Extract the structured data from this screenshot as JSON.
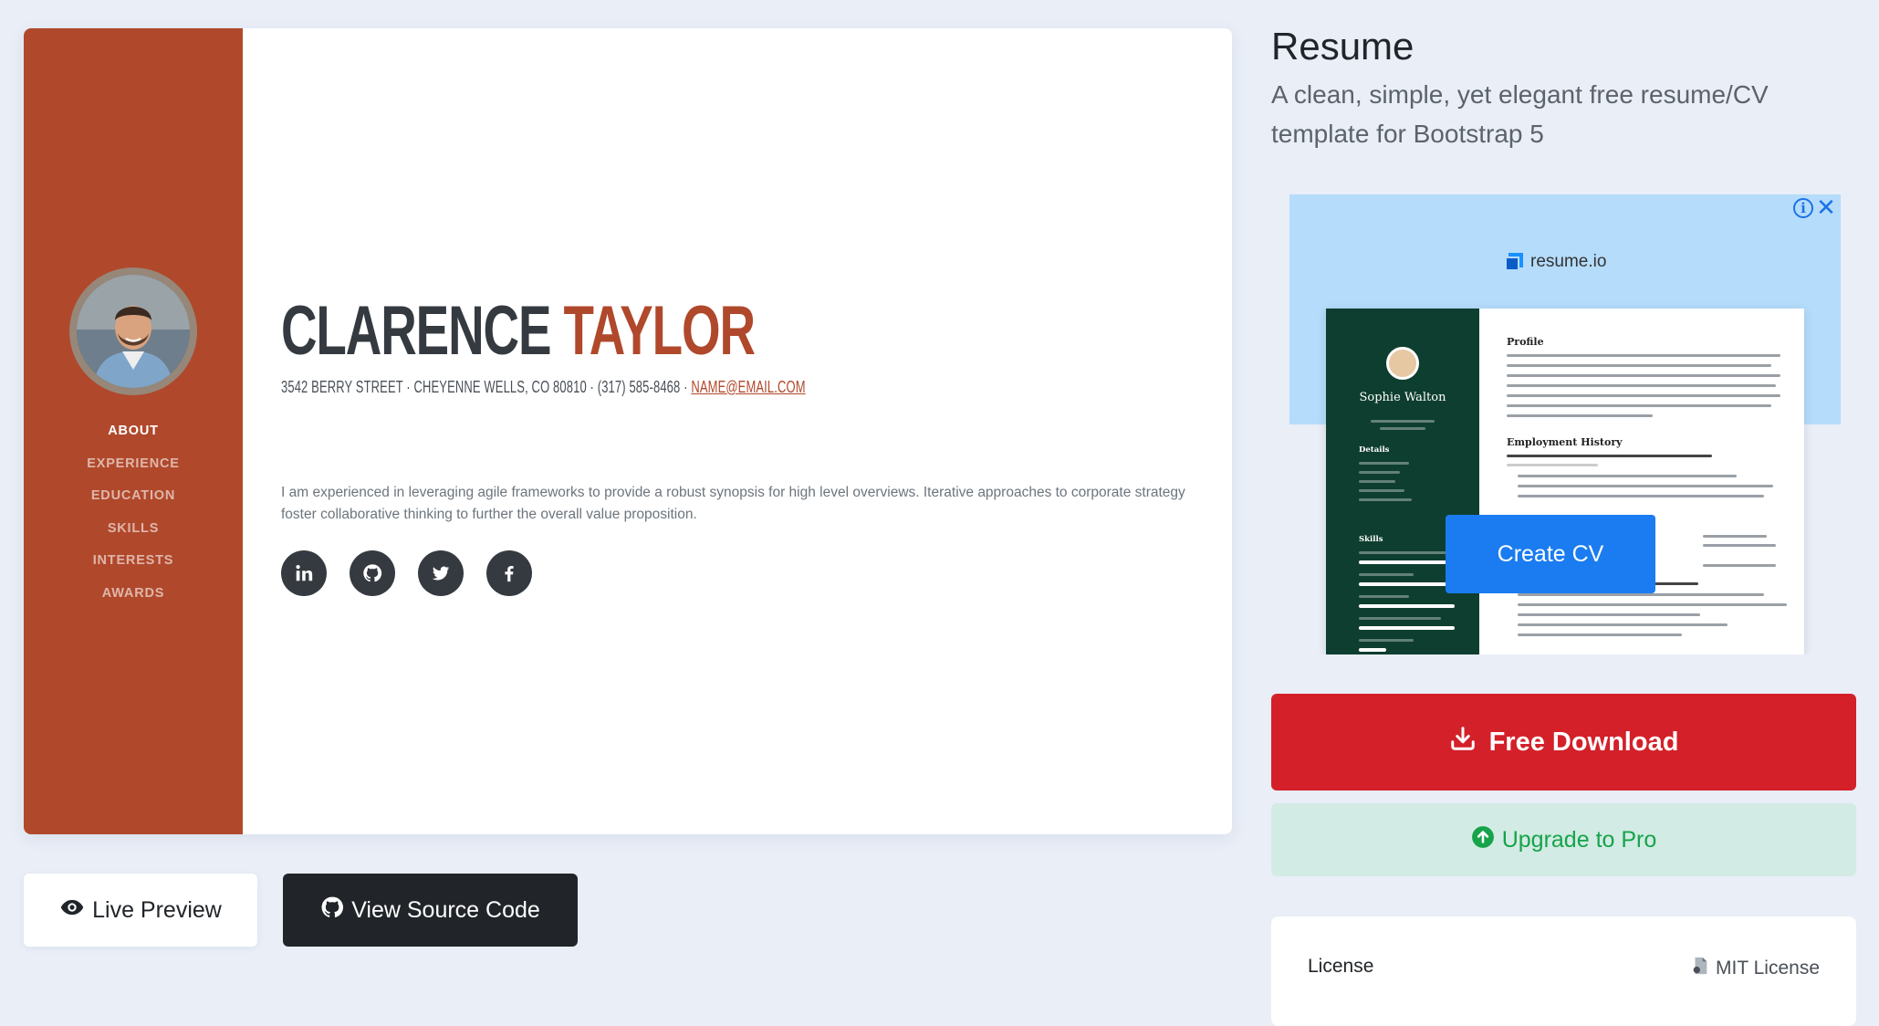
{
  "preview": {
    "nav": [
      "ABOUT",
      "EXPERIENCE",
      "EDUCATION",
      "SKILLS",
      "INTERESTS",
      "AWARDS"
    ],
    "first_name": "CLARENCE",
    "last_name": "TAYLOR",
    "address": "3542 BERRY STREET · CHEYENNE WELLS, CO 80810 · (317) 585-8468 · ",
    "email": "NAME@EMAIL.COM",
    "bio": "I am experienced in leveraging agile frameworks to provide a robust synopsis for high level overviews. Iterative approaches to corporate strategy foster collaborative thinking to further the overall value proposition.",
    "social_icons": [
      "linkedin-icon",
      "github-icon",
      "twitter-icon",
      "facebook-icon"
    ],
    "accent_color": "#b0482b"
  },
  "actions": {
    "live_preview": "Live Preview",
    "source_code": "View Source Code"
  },
  "product": {
    "title": "Resume",
    "subtitle": "A clean, simple, yet elegant free resume/CV template for Bootstrap 5"
  },
  "ad": {
    "brand": "resume.io",
    "person": "Sophie Walton",
    "section_profile": "Profile",
    "section_history": "Employment History",
    "section_details": "Details",
    "section_skills": "Skills",
    "cta": "Create CV"
  },
  "download": {
    "label": "Free Download",
    "color": "#d32029"
  },
  "upgrade": {
    "label": "Upgrade to Pro",
    "color": "#16a34a"
  },
  "license": {
    "label": "License",
    "value": "MIT License"
  }
}
